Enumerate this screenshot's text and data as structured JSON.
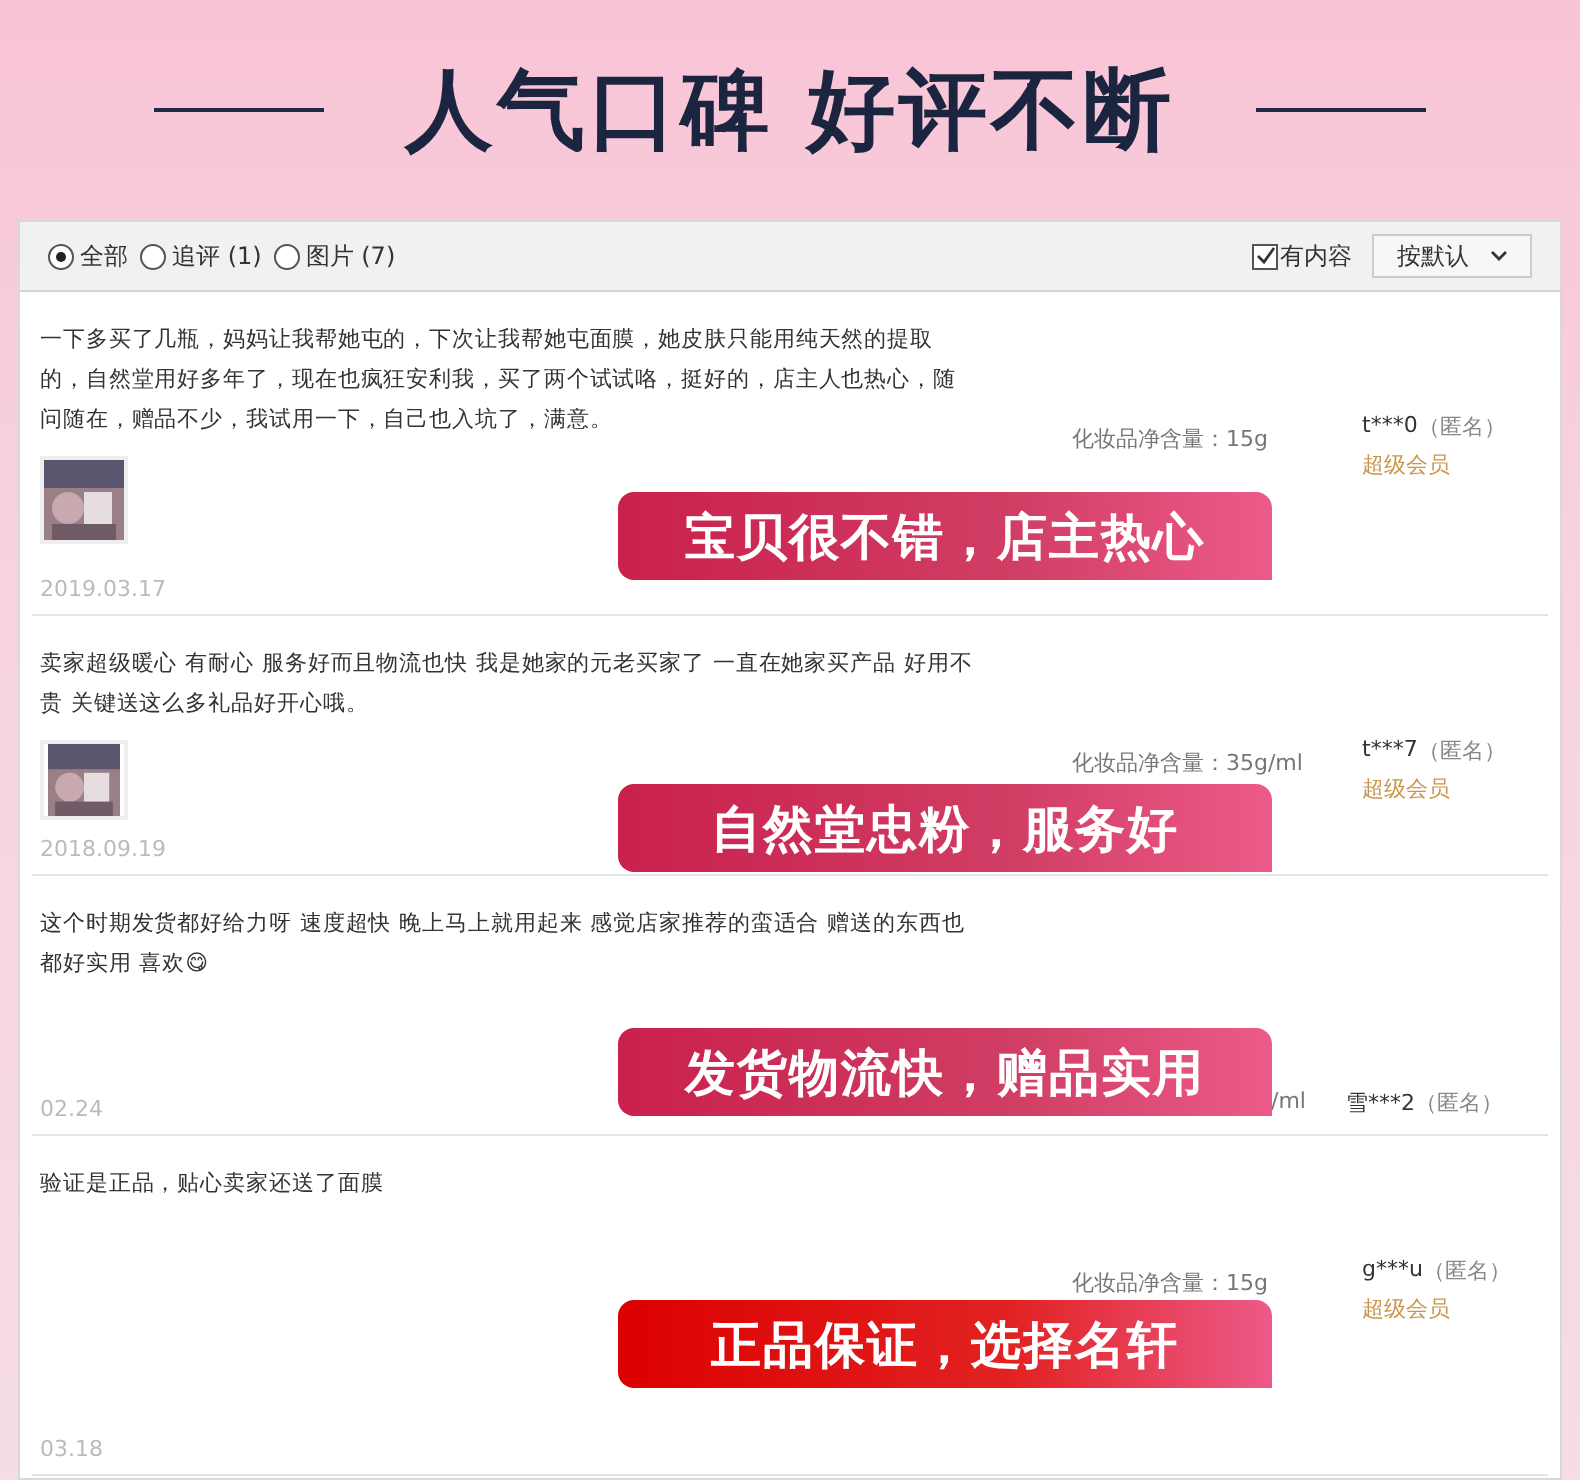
{
  "heading": "人气口碑 好评不断",
  "filters": [
    {
      "label": "全部",
      "selected": true
    },
    {
      "label": "追评 (1)",
      "selected": false
    },
    {
      "label": "图片 (7)",
      "selected": false
    }
  ],
  "content_filter": {
    "label": "有内容",
    "checked": true
  },
  "sort": {
    "label": "按默认"
  },
  "reviews": [
    {
      "text": "一下多买了几瓶，妈妈让我帮她屯的，下次让我帮她屯面膜，她皮肤只能用纯天然的提取的，自然堂用好多年了，现在也疯狂安利我，买了两个试试咯，挺好的，店主人也热心，随问随在，赠品不少，我试用一下，自己也入坑了，满意。",
      "date": "2019.03.17",
      "spec": "化妆品净含量：15g",
      "user": "t***0",
      "anon": "（匿名）",
      "member": "超级会员",
      "banner": {
        "text": "宝贝很不错，店主热心",
        "color": "#c9204c"
      }
    },
    {
      "text": "卖家超级暖心 有耐心 服务好而且物流也快 我是她家的元老买家了 一直在她家买产品 好用不贵 关键送这么多礼品好开心哦。",
      "date": "2018.09.19",
      "spec": "化妆品净含量：35g/ml",
      "user": "t***7",
      "anon": "（匿名）",
      "member": "超级会员",
      "banner": {
        "text": "自然堂忠粉，服务好",
        "color": "#c9204c"
      }
    },
    {
      "text": "这个时期发货都好给力呀 速度超快 晚上马上就用起来 感觉店家推荐的蛮适合 赠送的东西也都好实用 喜欢😋",
      "date": "02.24",
      "spec": "/ml",
      "user": "雪***2",
      "anon": "（匿名）",
      "banner": {
        "text": "发货物流快，赠品实用",
        "color": "#c9204c"
      }
    },
    {
      "text": "验证是正品，贴心卖家还送了面膜",
      "date": "03.18",
      "spec": "化妆品净含量：15g",
      "user": "g***u",
      "anon": "（匿名）",
      "member": "超级会员",
      "banner": {
        "text": "正品保证，选择名轩",
        "color": "#dd0000"
      }
    }
  ]
}
